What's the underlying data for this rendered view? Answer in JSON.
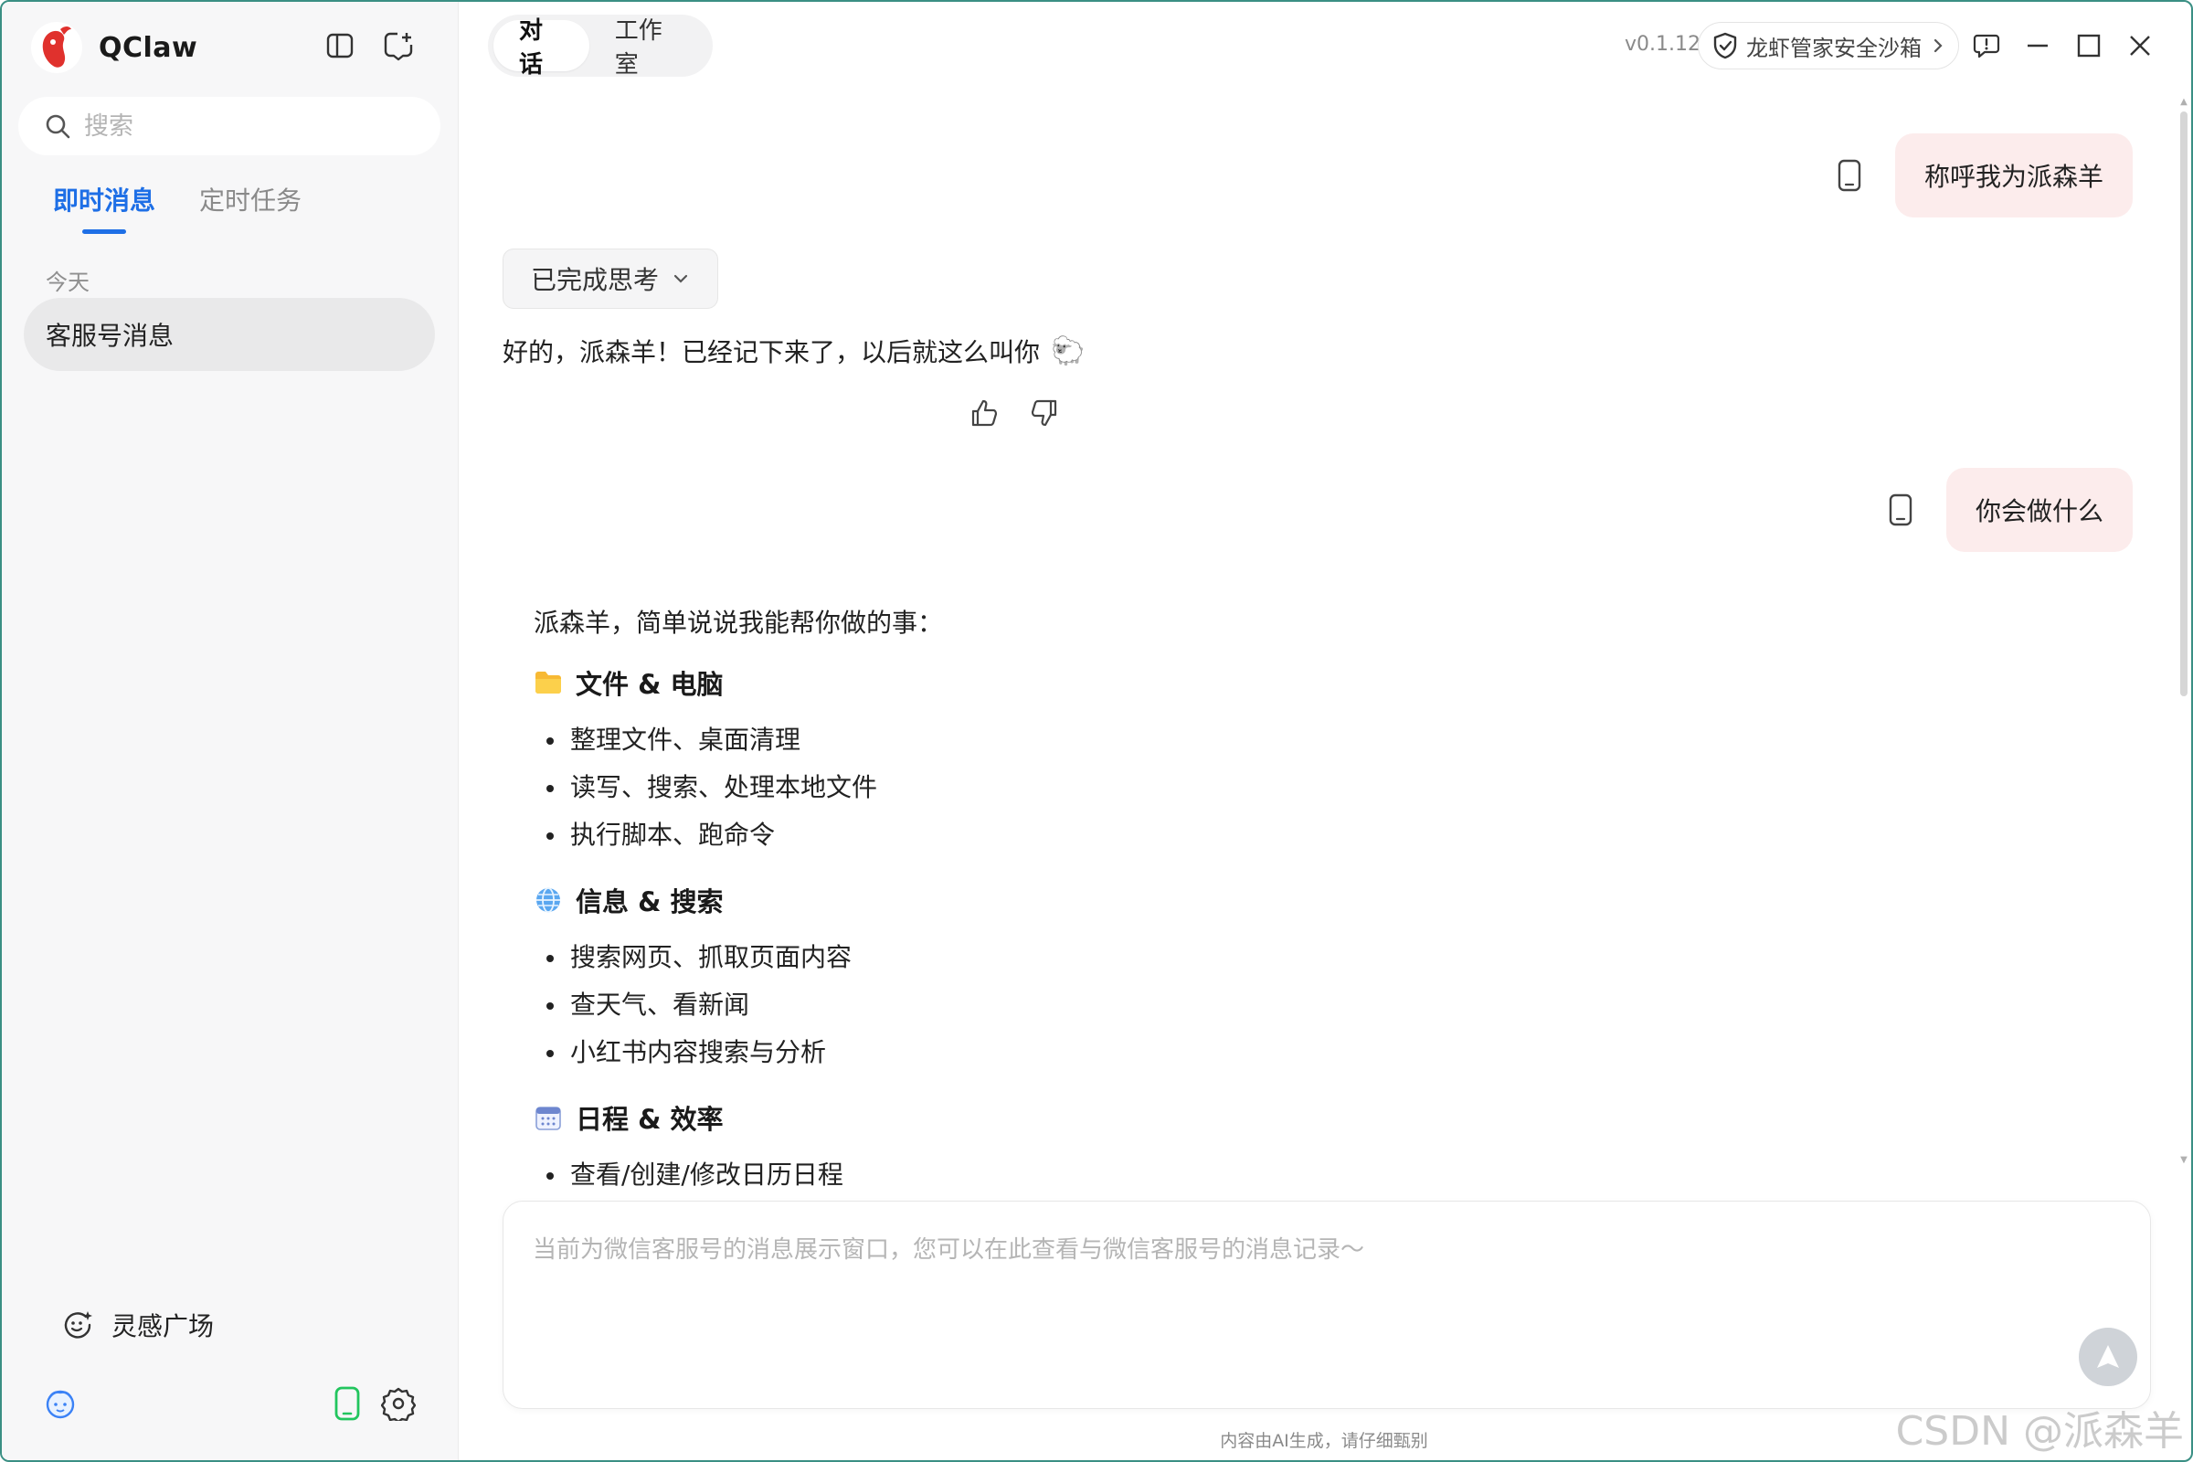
{
  "app": {
    "name": "QClaw",
    "version": "v0.1.12"
  },
  "sidebar": {
    "search_placeholder": "搜索",
    "tabs": [
      {
        "label": "即时消息",
        "active": true
      },
      {
        "label": "定时任务",
        "active": false
      }
    ],
    "group_label": "今天",
    "conversations": [
      {
        "label": "客服号消息",
        "selected": true
      }
    ],
    "inspire_label": "灵感广场"
  },
  "header": {
    "tabs": [
      {
        "label": "对话",
        "active": true
      },
      {
        "label": "工作室",
        "active": false
      }
    ],
    "sandbox_label": "龙虾管家安全沙箱"
  },
  "chat": {
    "user_messages": [
      "称呼我为派森羊",
      "你会做什么"
    ],
    "thinking_label": "已完成思考",
    "reply1": "好的，派森羊！已经记下来了，以后就这么叫你",
    "reply1_emoji": "🐑",
    "answer": {
      "intro": "派森羊，简单说说我能帮你做的事：",
      "sections": [
        {
          "icon": "folder-icon",
          "title": "文件 & 电脑",
          "items": [
            "整理文件、桌面清理",
            "读写、搜索、处理本地文件",
            "执行脚本、跑命令"
          ]
        },
        {
          "icon": "globe-icon",
          "title": "信息 & 搜索",
          "items": [
            "搜索网页、抓取页面内容",
            "查天气、看新闻",
            "小红书内容搜索与分析"
          ]
        },
        {
          "icon": "calendar-icon",
          "title": "日程 & 效率",
          "items": [
            "查看/创建/修改日历日程"
          ]
        }
      ]
    }
  },
  "composer": {
    "placeholder": "当前为微信客服号的消息展示窗口，您可以在此查看与微信客服号的消息记录～"
  },
  "footer": {
    "disclaimer": "内容由AI生成，请仔细甄别"
  },
  "watermark": "CSDN @派森羊",
  "colors": {
    "accent": "#1e6fe6",
    "user_bubble": "#fcecec",
    "window_border": "#3a8f84",
    "phone_icon": "#22c55e"
  }
}
